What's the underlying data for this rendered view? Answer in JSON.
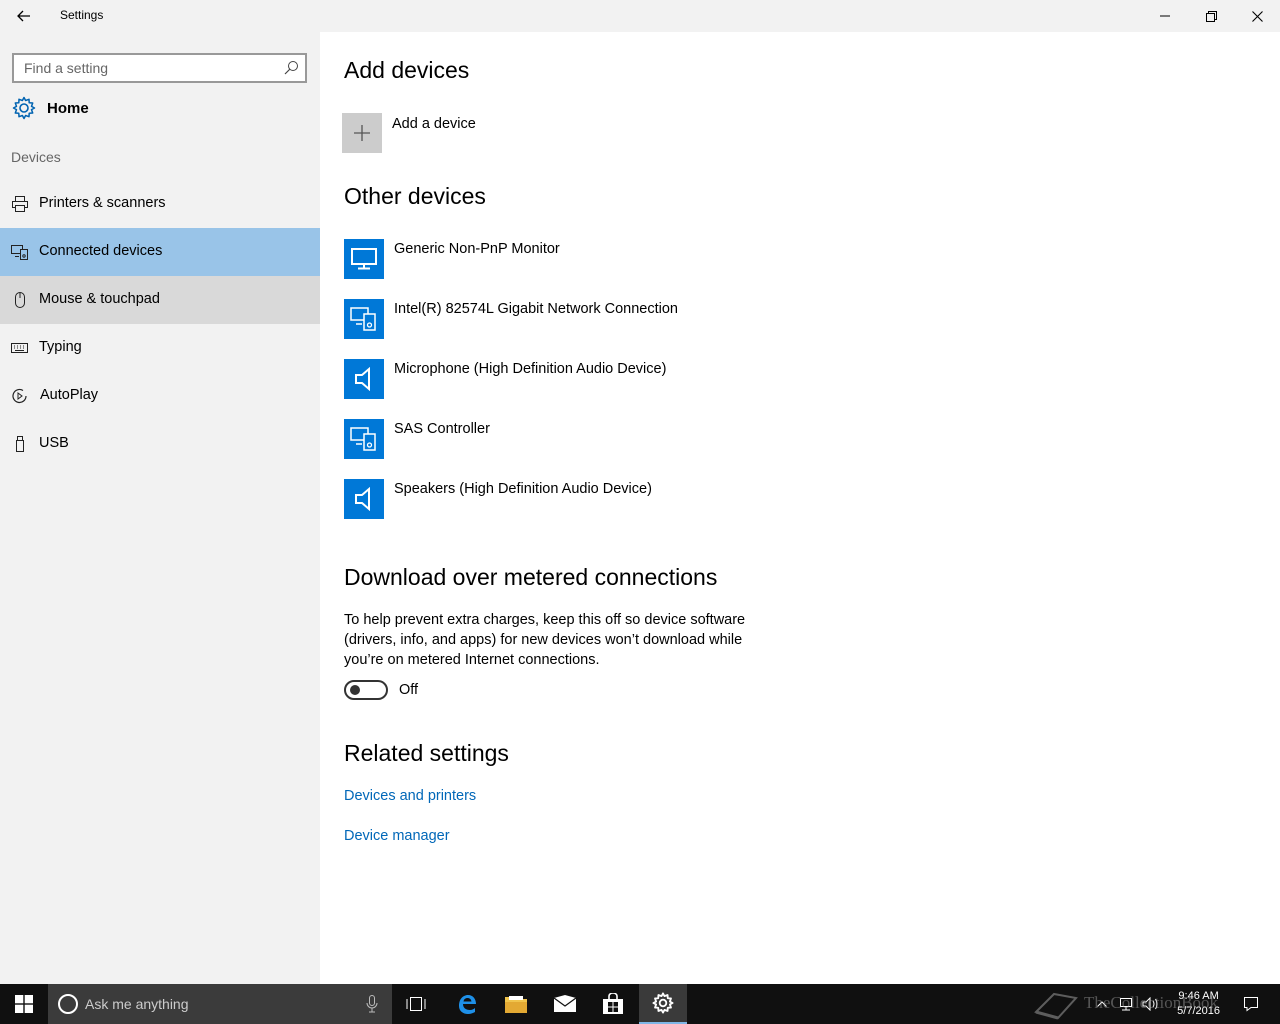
{
  "window": {
    "title": "Settings"
  },
  "sidebar": {
    "search_placeholder": "Find a setting",
    "home_label": "Home",
    "section_label": "Devices",
    "items": [
      {
        "label": "Printers & scanners",
        "icon": "printer-icon"
      },
      {
        "label": "Connected devices",
        "icon": "connected-devices-icon",
        "state": "selected"
      },
      {
        "label": "Mouse & touchpad",
        "icon": "mouse-icon",
        "state": "hover"
      },
      {
        "label": "Typing",
        "icon": "keyboard-icon"
      },
      {
        "label": "AutoPlay",
        "icon": "autoplay-icon"
      },
      {
        "label": "USB",
        "icon": "usb-icon"
      }
    ]
  },
  "main": {
    "add_devices_heading": "Add devices",
    "add_device_label": "Add a device",
    "other_devices_heading": "Other devices",
    "devices": [
      {
        "name": "Generic Non-PnP Monitor",
        "icon": "monitor-icon"
      },
      {
        "name": "Intel(R) 82574L Gigabit Network Connection",
        "icon": "devices-icon"
      },
      {
        "name": "Microphone (High Definition Audio Device)",
        "icon": "speaker-icon"
      },
      {
        "name": "SAS Controller",
        "icon": "devices-icon"
      },
      {
        "name": "Speakers (High Definition Audio Device)",
        "icon": "speaker-icon"
      }
    ],
    "metered_heading": "Download over metered connections",
    "metered_description": "To help prevent extra charges, keep this off so device software (drivers, info, and apps) for new devices won’t download while you’re on metered Internet connections.",
    "metered_toggle_state": "Off",
    "related_heading": "Related settings",
    "related_links": [
      "Devices and printers",
      "Device manager"
    ]
  },
  "taskbar": {
    "search_placeholder": "Ask me anything",
    "time": "9:46 AM",
    "date": "5/7/2016",
    "watermark": "TheCollectionBook",
    "active_app": "settings",
    "accent_color": "#0078d7"
  }
}
